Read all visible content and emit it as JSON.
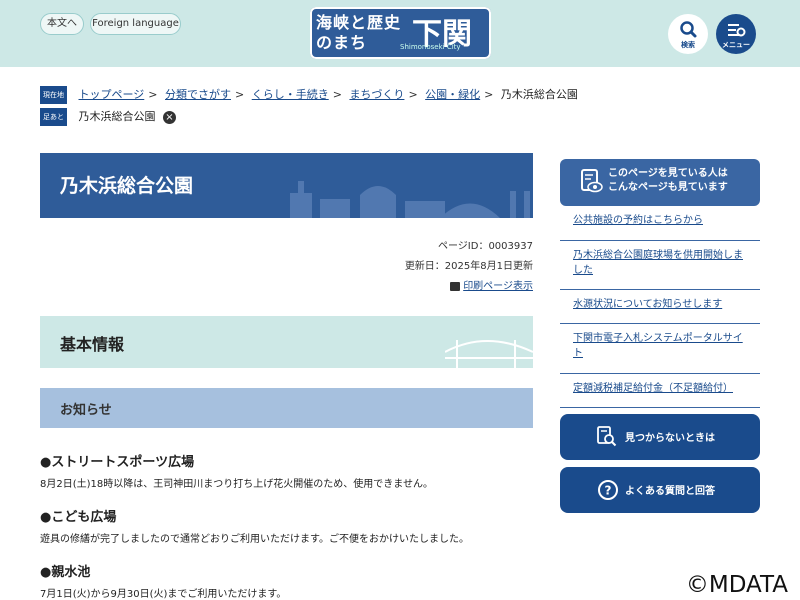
{
  "header": {
    "honbun_label": "本文へ",
    "foreign_label": "Foreign language",
    "logo_main": "海峡と歴史のまち",
    "logo_big": "下関",
    "logo_sub": "Shimonoseki City",
    "search_label": "検索",
    "menu_label": "メニュー"
  },
  "breadcrumb": {
    "current_tag": "現在地",
    "items": [
      "トップページ",
      "分類でさがす",
      "くらし・手続き",
      "まちづくり",
      "公園・緑化"
    ],
    "current": "乃木浜総合公園",
    "footprint_tag": "足あと",
    "footprint_item": "乃木浜総合公園"
  },
  "page": {
    "title": "乃木浜総合公園",
    "page_id": "ページID：0003937",
    "updated": "更新日：2025年8月1日更新",
    "print_label": "印刷ページ表示"
  },
  "content": {
    "h2": "基本情報",
    "h3": "お知らせ",
    "items": [
      {
        "heading": "●ストリートスポーツ広場",
        "body": "8月2日(土)18時以降は、王司神田川まつり打ち上げ花火開催のため、使用できません。"
      },
      {
        "heading": "●こども広場",
        "body": "遊具の修繕が完了しましたので通常どおりご利用いただけます。ご不便をおかけいたしました。"
      },
      {
        "heading": "●親水池",
        "body": "7月1日(火)から9月30日(火)までご利用いただけます。"
      }
    ]
  },
  "sidebar": {
    "heading": "このページを見ている人はこんなページも見ています",
    "heading_l1": "このページを見ている人は",
    "heading_l2": "こんなページも見ています",
    "links": [
      "公共施設の予約はこちらから",
      "乃木浜総合公園庭球場を供用開始しました",
      "水源状況についてお知らせします",
      "下関市電子入札システムポータルサイト",
      "定額減税補足給付金（不足額給付）"
    ],
    "not_found_label": "見つからないときは",
    "faq_label": "よくある質問と回答"
  },
  "watermark": "©MDATA",
  "colors": {
    "header_bg": "#cde8e6",
    "navy": "#1a4b8c",
    "title_blue": "#2f5c99",
    "h3_blue": "#a6c0de"
  }
}
